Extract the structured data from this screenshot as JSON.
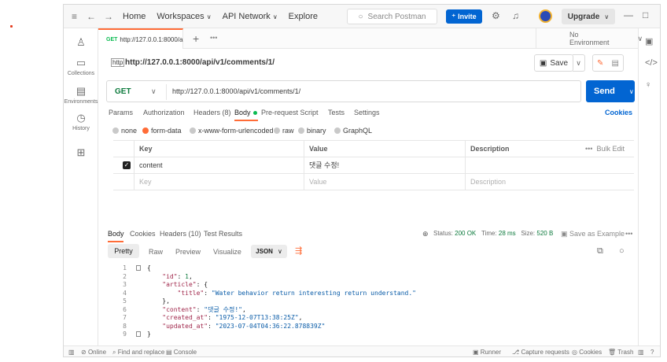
{
  "topbar": {
    "menu_icon": "hamburger-icon",
    "back_icon": "arrow-left-icon",
    "forward_icon": "arrow-right-icon",
    "nav": [
      "Home",
      "Workspaces",
      "API Network",
      "Explore"
    ],
    "search_placeholder": "Search Postman",
    "invite_label": "Invite",
    "upgrade_label": "Upgrade",
    "accent_color": "#ff6c37",
    "primary_color": "#0265d2"
  },
  "sidebar": {
    "items": [
      {
        "icon": "user-icon",
        "label": ""
      },
      {
        "icon": "trash-icon",
        "label": "Collections"
      },
      {
        "icon": "environment-icon",
        "label": "Environments"
      },
      {
        "icon": "history-icon",
        "label": "History"
      },
      {
        "icon": "grid-plus-icon",
        "label": ""
      }
    ]
  },
  "tab": {
    "method": "GET",
    "label": "http://127.0.0.1:8000/a",
    "more": "•••",
    "environment": "No Environment"
  },
  "request": {
    "title_icon": "http",
    "title": "http://127.0.0.1:8000/api/v1/comments/1/",
    "save_label": "Save",
    "method": "GET",
    "url": "http://127.0.0.1:8000/api/v1/comments/1/",
    "send_label": "Send",
    "tabs": [
      {
        "label": "Params"
      },
      {
        "label": "Authorization"
      },
      {
        "label": "Headers (8)"
      },
      {
        "label": "Body"
      },
      {
        "label": "Pre-request Script"
      },
      {
        "label": "Tests"
      },
      {
        "label": "Settings"
      }
    ],
    "cookies_label": "Cookies",
    "body_types": [
      "none",
      "form-data",
      "x-www-form-urlencoded",
      "raw",
      "binary",
      "GraphQL"
    ],
    "selected_body_type": "form-data",
    "table": {
      "headers": [
        "Key",
        "Value",
        "Description"
      ],
      "bulk_edit": "Bulk Edit",
      "bulk_dots": "•••",
      "rows": [
        {
          "checked": true,
          "key": "content",
          "value": "댓글 수정!",
          "description": ""
        }
      ],
      "placeholder": {
        "key": "Key",
        "value": "Value",
        "description": "Description"
      }
    }
  },
  "response": {
    "tabs": [
      "Body",
      "Cookies",
      "Headers (10)",
      "Test Results"
    ],
    "status_label": "Status:",
    "status_value": "200 OK",
    "time_label": "Time:",
    "time_value": "28 ms",
    "size_label": "Size:",
    "size_value": "520 B",
    "save_example": "Save as Example",
    "more": "•••",
    "formats": [
      "Pretty",
      "Raw",
      "Preview",
      "Visualize"
    ],
    "selected_format": "Pretty",
    "language": "JSON",
    "lines": [
      {
        "n": "1",
        "text": "{"
      },
      {
        "n": "2",
        "key": "\"id\"",
        "value": "1",
        "type": "num",
        "indent": 1,
        "trail": ","
      },
      {
        "n": "3",
        "key": "\"article\"",
        "value": "{",
        "type": "open",
        "indent": 1,
        "trail": ""
      },
      {
        "n": "4",
        "key": "\"title\"",
        "value": "\"Water behavior return interesting return understand.\"",
        "type": "str",
        "indent": 2,
        "trail": ""
      },
      {
        "n": "5",
        "text": "    },"
      },
      {
        "n": "6",
        "key": "\"content\"",
        "value": "\"댓글 수정!\"",
        "type": "str",
        "indent": 1,
        "trail": ","
      },
      {
        "n": "7",
        "key": "\"created_at\"",
        "value": "\"1975-12-07T13:38:25Z\"",
        "type": "str",
        "indent": 1,
        "trail": ","
      },
      {
        "n": "8",
        "key": "\"updated_at\"",
        "value": "\"2023-07-04T04:36:22.878839Z\"",
        "type": "str",
        "indent": 1,
        "trail": ""
      },
      {
        "n": "9",
        "text": "}"
      }
    ]
  },
  "statusbar": {
    "online": "Online",
    "find_replace": "Find and replace",
    "console": "Console",
    "runner": "Runner",
    "capture": "Capture requests",
    "cookies": "Cookies",
    "trash": "Trash"
  }
}
